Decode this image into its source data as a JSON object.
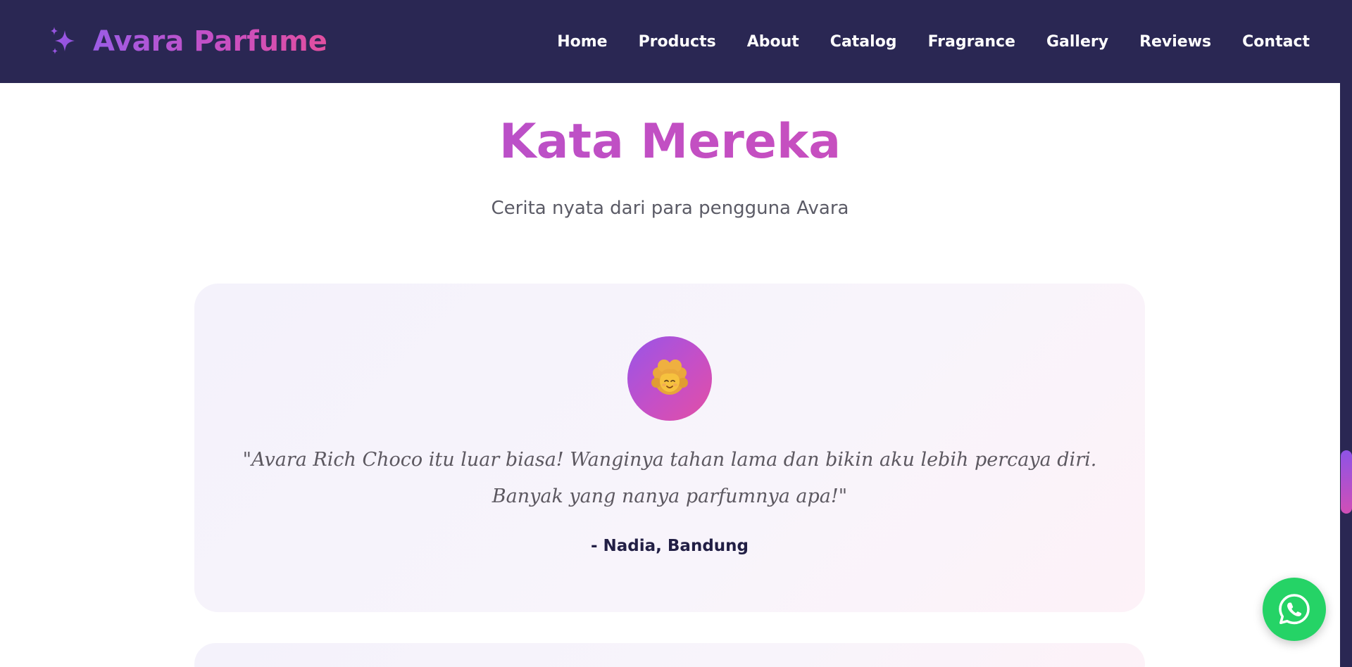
{
  "brand": {
    "name": "Avara Parfume",
    "icon": "sparkles-icon"
  },
  "nav": {
    "items": [
      {
        "label": "Home"
      },
      {
        "label": "Products"
      },
      {
        "label": "About"
      },
      {
        "label": "Catalog"
      },
      {
        "label": "Fragrance"
      },
      {
        "label": "Gallery"
      },
      {
        "label": "Reviews"
      },
      {
        "label": "Contact"
      }
    ]
  },
  "section": {
    "title": "Kata Mereka",
    "subtitle": "Cerita nyata dari para pengguna Avara"
  },
  "testimonial": {
    "avatar_icon": "woman-emoji-icon",
    "quote_line1": "\"Avara Rich Choco itu luar biasa! Wanginya tahan lama dan bikin aku lebih percaya diri.",
    "quote_line2": "Banyak yang nanya parfumnya apa!\"",
    "author": "- Nadia, Bandung"
  },
  "whatsapp": {
    "icon": "whatsapp-icon"
  },
  "colors": {
    "navbar_bg": "#2a2753",
    "accent_purple": "#9c5ce6",
    "accent_pink": "#e24f9f",
    "whatsapp_green": "#25d366"
  }
}
